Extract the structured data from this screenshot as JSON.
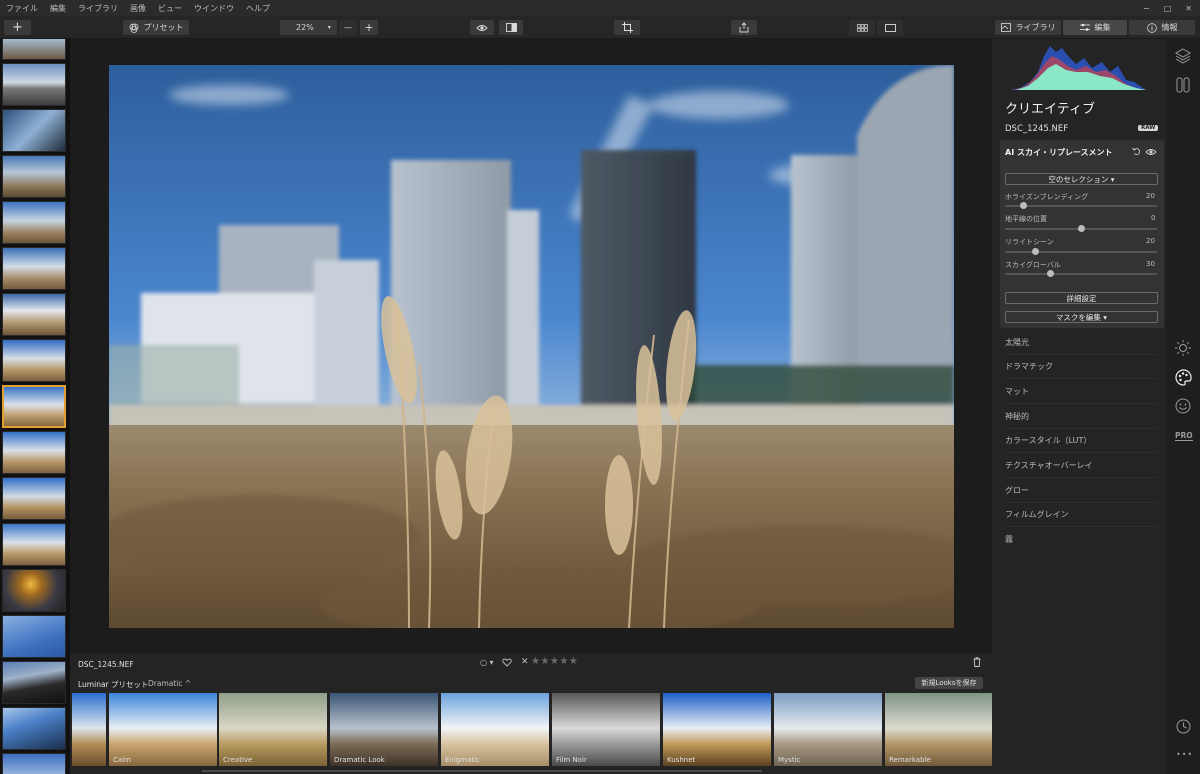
{
  "menu": [
    "ファイル",
    "編集",
    "ライブラリ",
    "画像",
    "ビュー",
    "ウインドウ",
    "ヘルプ"
  ],
  "window_controls": [
    "−",
    "□",
    "✕"
  ],
  "toolbar": {
    "add_label": "+",
    "preset_label": "プリセット",
    "zoom_value": "22%",
    "zoom_minus": "—",
    "zoom_plus": "+",
    "library_label": "ライブラリ",
    "edit_label": "編集",
    "info_label": "情報"
  },
  "right_panel": {
    "section_title": "クリエイティブ",
    "filename": "DSC_1245.NEF",
    "raw_badge": "RAW",
    "tool_title": "AI スカイ・リプレースメント",
    "sky_select_label": "空のセレクション ▾",
    "sliders": [
      {
        "label": "ホライズンブレンディング",
        "value": "20",
        "level": 0.12
      },
      {
        "label": "地平線の位置",
        "value": "0",
        "level": 0.5
      },
      {
        "label": "リライトシーン",
        "value": "20",
        "level": 0.2
      },
      {
        "label": "スカイグローバル",
        "value": "30",
        "level": 0.3
      }
    ],
    "advanced_label": "詳細設定",
    "edit_mask_label": "マスクを編集 ▾",
    "filters": [
      "太陽光",
      "ドラマチック",
      "マット",
      "神秘的",
      "カラースタイル（LUT）",
      "テクスチャオーバーレイ",
      "グロー",
      "フィルムグレイン",
      "霧"
    ]
  },
  "icon_strip": {
    "pro_label": "PRO",
    "more_label": "•••"
  },
  "bottom": {
    "filename": "DSC_1245.NEF",
    "flag_label": "○ ▾",
    "reject_label": "✕",
    "stars": "★★★★★",
    "presets_label": "Luminar プリセット",
    "category_label": "Dramatic ^",
    "save_looks_label": "新規Looksを保存",
    "looks": [
      "",
      "Calm",
      "Creative",
      "Dramatic Look",
      "Enigmatic",
      "Film Noir",
      "Kushnet",
      "Mystic",
      "Remarkable"
    ]
  }
}
